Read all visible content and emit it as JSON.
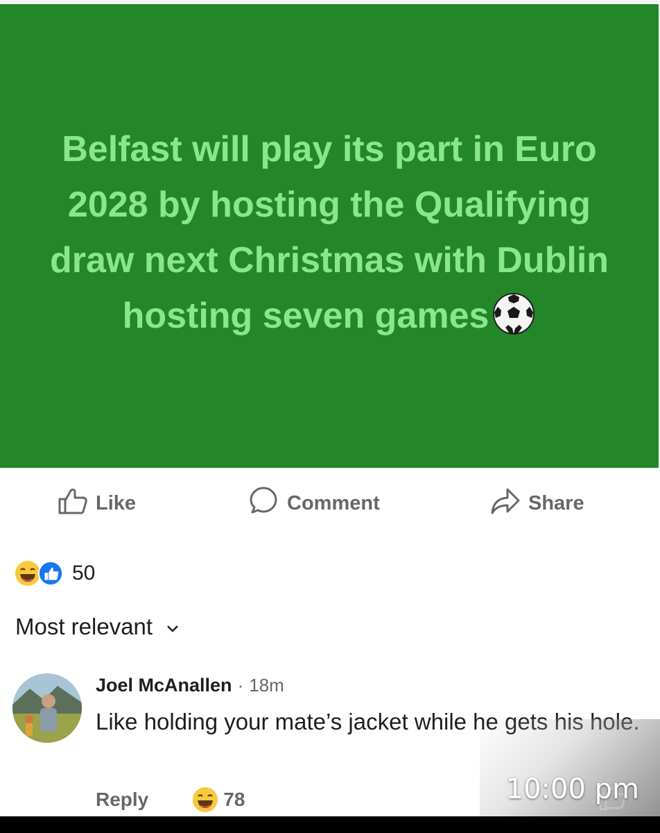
{
  "post": {
    "text": "Belfast will play its part in Euro 2028 by hosting the Qualifying draw next Christmas with Dublin hosting seven games",
    "emoji_icon": "soccer-ball-icon",
    "background_color": "#23872a",
    "text_color": "#8ae68c"
  },
  "actions": {
    "like_label": "Like",
    "comment_label": "Comment",
    "share_label": "Share"
  },
  "reactions": {
    "icons": [
      "laughing-emoji-icon",
      "like-reaction-icon"
    ],
    "count": "50"
  },
  "sort": {
    "label": "Most relevant"
  },
  "comment": {
    "author": "Joel McAnallen",
    "separator": "·",
    "time": "18m",
    "text": "Like holding your mate’s jacket while he gets his hole.",
    "reply_label": "Reply",
    "reaction_icon": "laughing-emoji-icon",
    "reaction_count": "78"
  },
  "overlay": {
    "timestamp": "10:00 pm"
  }
}
